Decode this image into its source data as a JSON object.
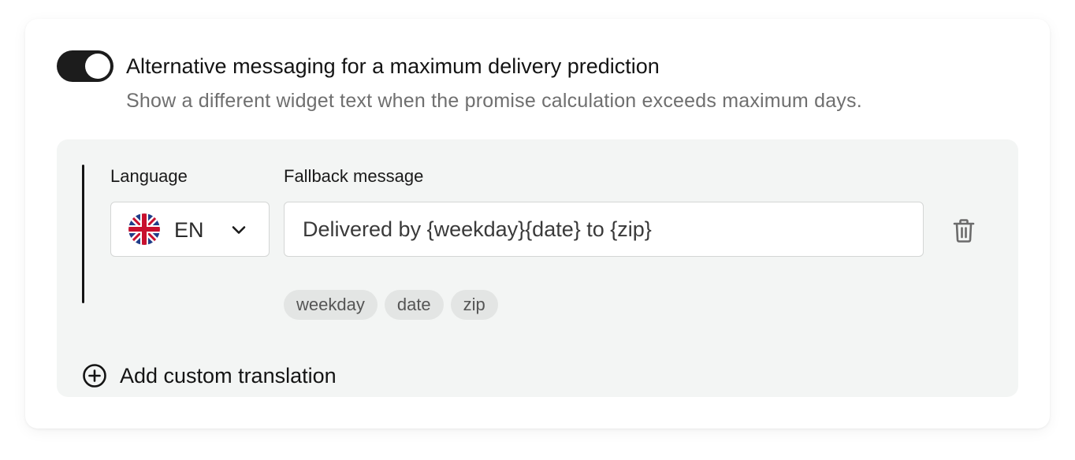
{
  "setting": {
    "toggle_on": true,
    "title": "Alternative messaging for a maximum delivery prediction",
    "description": "Show a different widget text when the promise calculation exceeds maximum days."
  },
  "translation": {
    "language_label": "Language",
    "message_label": "Fallback message",
    "language": {
      "value": "EN",
      "flag_icon": "uk-flag-icon"
    },
    "message_value": "Delivered by {weekday}{date} to {zip}",
    "variables": [
      "weekday",
      "date",
      "zip"
    ]
  },
  "actions": {
    "add_label": "Add custom translation",
    "delete_icon": "trash-icon",
    "add_icon": "plus-circle-icon"
  },
  "colors": {
    "toggle": "#1c1c1c",
    "panel_bg": "#f3f5f4",
    "chip_bg": "#e3e5e4",
    "muted_text": "#6f6f6f"
  }
}
